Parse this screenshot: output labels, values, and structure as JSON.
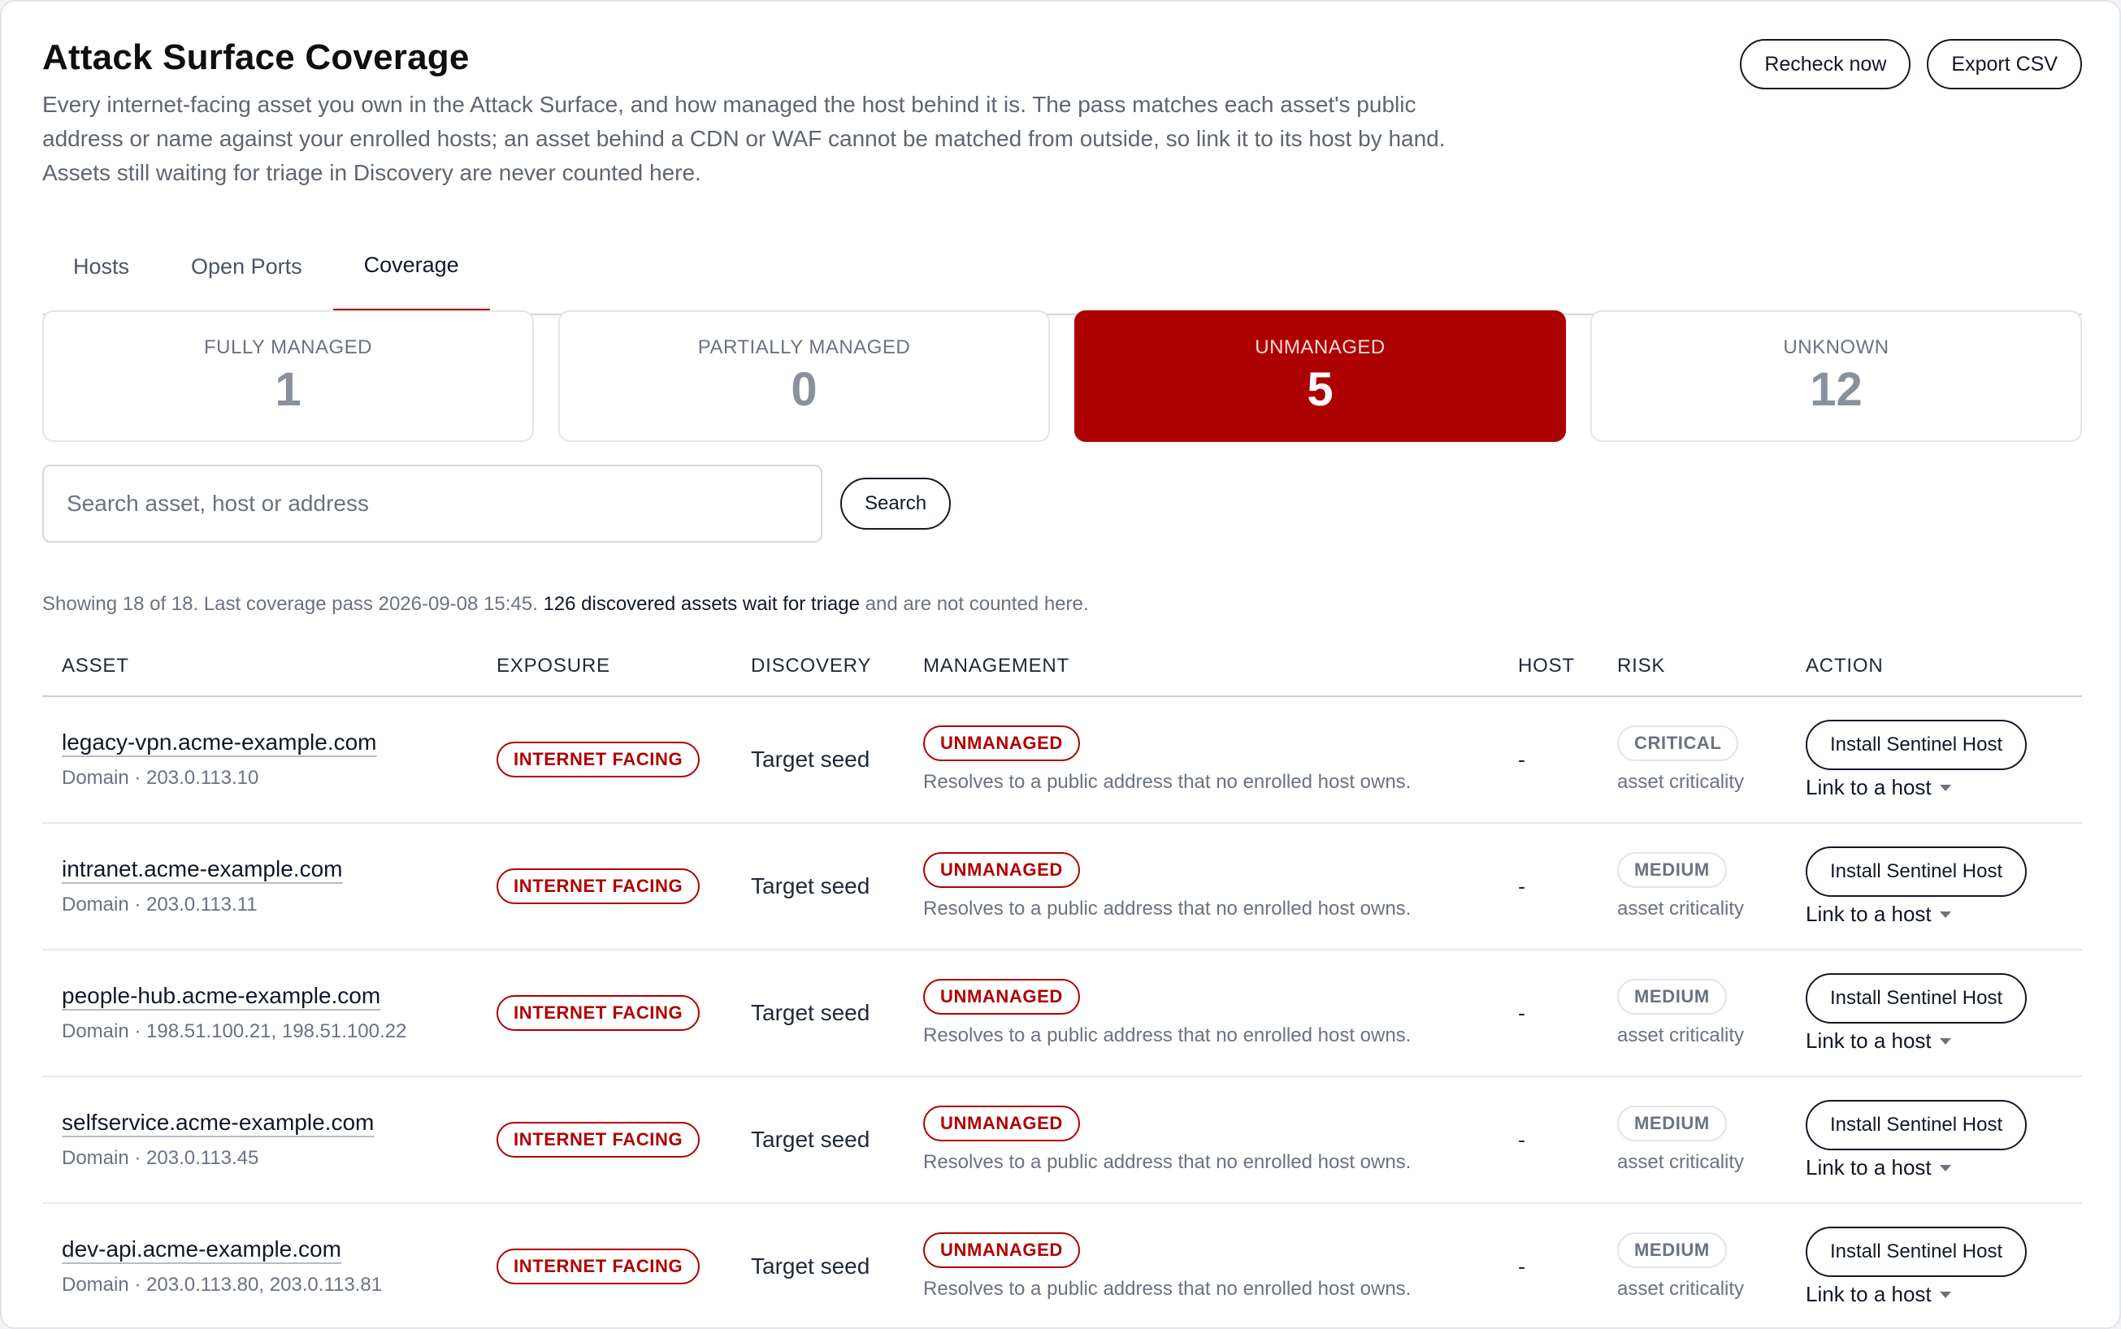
{
  "page": {
    "title": "Attack Surface Coverage",
    "description": "Every internet-facing asset you own in the Attack Surface, and how managed the host behind it is. The pass matches each asset's public address or name against your enrolled hosts; an asset behind a CDN or WAF cannot be matched from outside, so link it to its host by hand. Assets still waiting for triage in Discovery are never counted here."
  },
  "actions": {
    "recheck": "Recheck now",
    "export": "Export CSV"
  },
  "tabs": [
    {
      "label": "Hosts",
      "active": false
    },
    {
      "label": "Open Ports",
      "active": false
    },
    {
      "label": "Coverage",
      "active": true
    }
  ],
  "summary": [
    {
      "label": "FULLY MANAGED",
      "value": "1",
      "active": false
    },
    {
      "label": "PARTIALLY MANAGED",
      "value": "0",
      "active": false
    },
    {
      "label": "UNMANAGED",
      "value": "5",
      "active": true
    },
    {
      "label": "UNKNOWN",
      "value": "12",
      "active": false
    }
  ],
  "search": {
    "placeholder": "Search asset, host or address",
    "value": "",
    "button": "Search"
  },
  "meta": {
    "prefix": "Showing 18 of 18. Last coverage pass 2026-09-08 15:45.",
    "link": "126 discovered assets wait for triage",
    "suffix": "and are not counted here."
  },
  "table": {
    "columns": [
      "ASSET",
      "EXPOSURE",
      "DISCOVERY",
      "MANAGEMENT",
      "HOST",
      "RISK",
      "ACTION"
    ],
    "rows": [
      {
        "asset": "legacy-vpn.acme-example.com",
        "sub": "Domain · 203.0.113.10",
        "exposure": "INTERNET FACING",
        "discovery": "Target seed",
        "management": "UNMANAGED",
        "management_note": "Resolves to a public address that no enrolled host owns.",
        "host": "-",
        "risk": "CRITICAL",
        "risk_note": "asset criticality",
        "action": "Install Sentinel Host",
        "link": "Link to a host"
      },
      {
        "asset": "intranet.acme-example.com",
        "sub": "Domain · 203.0.113.11",
        "exposure": "INTERNET FACING",
        "discovery": "Target seed",
        "management": "UNMANAGED",
        "management_note": "Resolves to a public address that no enrolled host owns.",
        "host": "-",
        "risk": "MEDIUM",
        "risk_note": "asset criticality",
        "action": "Install Sentinel Host",
        "link": "Link to a host"
      },
      {
        "asset": "people-hub.acme-example.com",
        "sub": "Domain · 198.51.100.21, 198.51.100.22",
        "exposure": "INTERNET FACING",
        "discovery": "Target seed",
        "management": "UNMANAGED",
        "management_note": "Resolves to a public address that no enrolled host owns.",
        "host": "-",
        "risk": "MEDIUM",
        "risk_note": "asset criticality",
        "action": "Install Sentinel Host",
        "link": "Link to a host"
      },
      {
        "asset": "selfservice.acme-example.com",
        "sub": "Domain · 203.0.113.45",
        "exposure": "INTERNET FACING",
        "discovery": "Target seed",
        "management": "UNMANAGED",
        "management_note": "Resolves to a public address that no enrolled host owns.",
        "host": "-",
        "risk": "MEDIUM",
        "risk_note": "asset criticality",
        "action": "Install Sentinel Host",
        "link": "Link to a host"
      },
      {
        "asset": "dev-api.acme-example.com",
        "sub": "Domain · 203.0.113.80, 203.0.113.81",
        "exposure": "INTERNET FACING",
        "discovery": "Target seed",
        "management": "UNMANAGED",
        "management_note": "Resolves to a public address that no enrolled host owns.",
        "host": "-",
        "risk": "MEDIUM",
        "risk_note": "asset criticality",
        "action": "Install Sentinel Host",
        "link": "Link to a host"
      }
    ]
  },
  "colors": {
    "accent": "#ad0000",
    "text": "#111827",
    "muted": "#6b7280",
    "border": "#e2e5ea"
  }
}
